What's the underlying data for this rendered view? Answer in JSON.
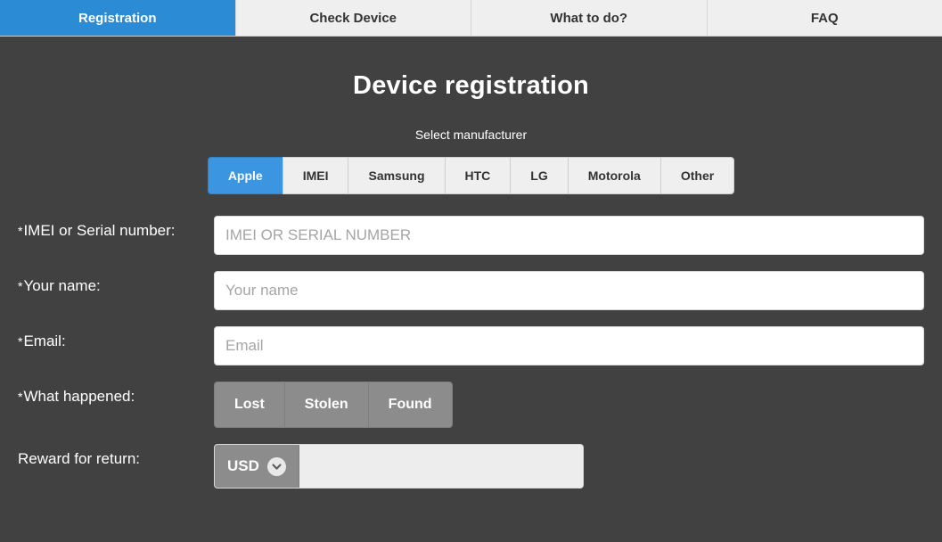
{
  "nav": {
    "tabs": [
      {
        "label": "Registration",
        "active": true
      },
      {
        "label": "Check Device",
        "active": false
      },
      {
        "label": "What to do?",
        "active": false
      },
      {
        "label": "FAQ",
        "active": false
      }
    ]
  },
  "main": {
    "title": "Device registration",
    "manufacturer_label": "Select manufacturer",
    "manufacturers": [
      {
        "label": "Apple",
        "active": true
      },
      {
        "label": "IMEI",
        "active": false
      },
      {
        "label": "Samsung",
        "active": false
      },
      {
        "label": "HTC",
        "active": false
      },
      {
        "label": "LG",
        "active": false
      },
      {
        "label": "Motorola",
        "active": false
      },
      {
        "label": "Other",
        "active": false
      }
    ],
    "fields": {
      "imei": {
        "required_mark": "*",
        "label": "IMEI or Serial number:",
        "placeholder": "IMEI OR SERIAL NUMBER",
        "value": ""
      },
      "name": {
        "required_mark": "*",
        "label": "Your name:",
        "placeholder": "Your name",
        "value": ""
      },
      "email": {
        "required_mark": "*",
        "label": "Email:",
        "placeholder": "Email",
        "value": ""
      },
      "what_happened": {
        "required_mark": "*",
        "label": "What happened:",
        "options": [
          "Lost",
          "Stolen",
          "Found"
        ]
      },
      "reward": {
        "label": "Reward for return:",
        "currency": "USD",
        "placeholder": "",
        "value": ""
      }
    }
  },
  "colors": {
    "accent": "#2b8bd4",
    "manufacturer_active": "#3b95e0",
    "page_background": "#414141",
    "nav_background": "#efefef",
    "button_grey": "#8c8c8c"
  }
}
